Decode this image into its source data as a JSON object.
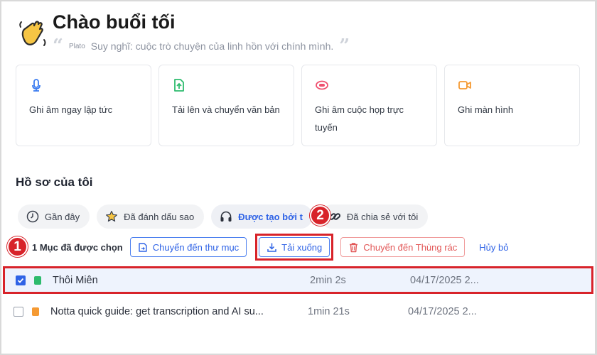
{
  "header": {
    "greeting": "Chào buổi tối",
    "quote_author": "Plato",
    "quote_text": "Suy nghĩ: cuộc trò chuyện của linh hồn với chính mình."
  },
  "cards": [
    {
      "label": "Ghi âm ngay lập tức",
      "icon": "microphone-icon",
      "color": "#3b7cf0"
    },
    {
      "label": "Tải lên và chuyển văn bản",
      "icon": "file-upload-icon",
      "color": "#2dbb6d"
    },
    {
      "label": "Ghi âm cuộc họp trực tuyến",
      "icon": "meeting-record-icon",
      "color": "#ef4f6e"
    },
    {
      "label": "Ghi màn hình",
      "icon": "video-camera-icon",
      "color": "#f59a33"
    }
  ],
  "section": {
    "title": "Hồ sơ của tôi"
  },
  "tabs": [
    {
      "label": "Gần đây",
      "icon": "clock-icon"
    },
    {
      "label": "Đã đánh dấu sao",
      "icon": "star-icon"
    },
    {
      "label": "Được tạo bởi t",
      "icon": "headphones-icon",
      "active": true
    },
    {
      "label": "Đã chia sẻ với tôi",
      "icon": "link-icon"
    }
  ],
  "toolbar": {
    "selected_count": "1 Mục đã được chọn",
    "move_label": "Chuyển đến thư mục",
    "download_label": "Tải xuống",
    "trash_label": "Chuyển đến Thùng rác",
    "cancel_label": "Hủy bỏ"
  },
  "badges": {
    "one": "1",
    "two": "2"
  },
  "files": [
    {
      "name": "Thôi Miên",
      "duration": "2min 2s",
      "date": "04/17/2025 2...",
      "checked": true,
      "type_color": "#2dbb6d"
    },
    {
      "name": "Notta quick guide: get transcription and AI su...",
      "duration": "1min 21s",
      "date": "04/17/2025 2...",
      "checked": false,
      "type_color": "#f59a33"
    }
  ],
  "colors": {
    "accent": "#2f63e6",
    "danger": "#e25757",
    "highlight": "#d8232a"
  }
}
